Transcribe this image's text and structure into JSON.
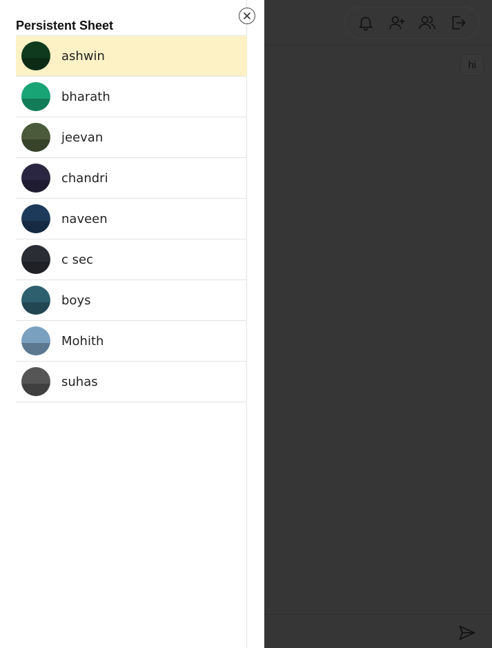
{
  "sheet": {
    "title": "Persistent Sheet",
    "close_icon": "close-circle-icon"
  },
  "contacts": [
    {
      "name": "ashwin",
      "active": true,
      "avatar_color": "#0f3a1d"
    },
    {
      "name": "bharath",
      "active": false,
      "avatar_color": "#19a476"
    },
    {
      "name": "jeevan",
      "active": false,
      "avatar_color": "#4a5a3a"
    },
    {
      "name": "chandri",
      "active": false,
      "avatar_color": "#2a2540"
    },
    {
      "name": "naveen",
      "active": false,
      "avatar_color": "#1e3a5a"
    },
    {
      "name": "c sec",
      "active": false,
      "avatar_color": "#2a2d33"
    },
    {
      "name": "boys",
      "active": false,
      "avatar_color": "#2e5f6f"
    },
    {
      "name": "Mohith",
      "active": false,
      "avatar_color": "#7aa0c0"
    },
    {
      "name": "suhas",
      "active": false,
      "avatar_color": "#555555"
    }
  ],
  "header_icons": [
    "bell-icon",
    "add-user-icon",
    "users-icon",
    "logout-icon"
  ],
  "chat": {
    "message": "hi",
    "send_icon": "send-icon"
  },
  "colors": {
    "overlay": "#363636",
    "active_row": "#fdf1c6"
  }
}
